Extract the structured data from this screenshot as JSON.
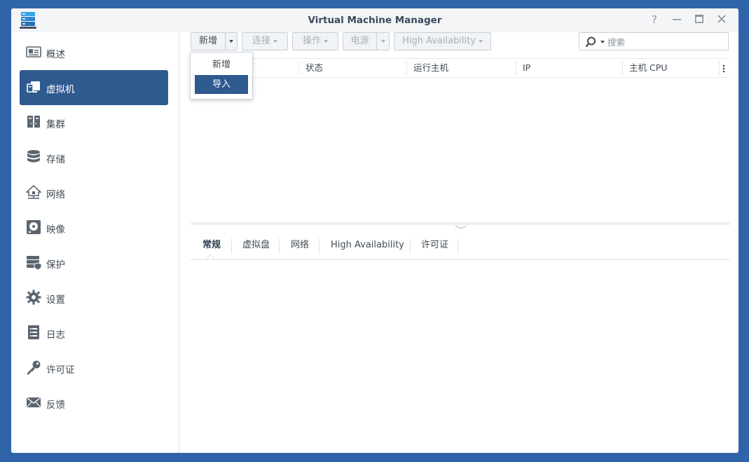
{
  "window": {
    "title": "Virtual Machine Manager",
    "controls": [
      "help-icon",
      "minimize-icon",
      "maximize-icon",
      "close-icon"
    ]
  },
  "sidebar": {
    "items": [
      {
        "label": "概述",
        "icon": "overview-icon"
      },
      {
        "label": "虚拟机",
        "icon": "virtual-machine-icon",
        "active": true
      },
      {
        "label": "集群",
        "icon": "cluster-icon"
      },
      {
        "label": "存储",
        "icon": "storage-icon"
      },
      {
        "label": "网络",
        "icon": "network-icon"
      },
      {
        "label": "映像",
        "icon": "image-disc-icon"
      },
      {
        "label": "保护",
        "icon": "protection-icon"
      },
      {
        "label": "设置",
        "icon": "gear-icon"
      },
      {
        "label": "日志",
        "icon": "log-icon"
      },
      {
        "label": "许可证",
        "icon": "key-icon"
      },
      {
        "label": "反馈",
        "icon": "mail-icon"
      }
    ]
  },
  "toolbar": {
    "create_label": "新增",
    "connect_label": "连接",
    "action_label": "操作",
    "power_label": "电源",
    "ha_label": "High Availability"
  },
  "search": {
    "placeholder": "搜索"
  },
  "grid": {
    "columns": [
      "状态",
      "运行主机",
      "IP",
      "主机 CPU"
    ]
  },
  "create_menu": {
    "items": [
      "新增",
      "导入"
    ],
    "selected": "导入"
  },
  "detail_tabs": {
    "items": [
      "常规",
      "虚拟盘",
      "网络",
      "High Availability",
      "许可证"
    ],
    "active": "常规"
  },
  "colors": {
    "accent": "#2e5a8f",
    "desktop": "#2f64a8"
  }
}
